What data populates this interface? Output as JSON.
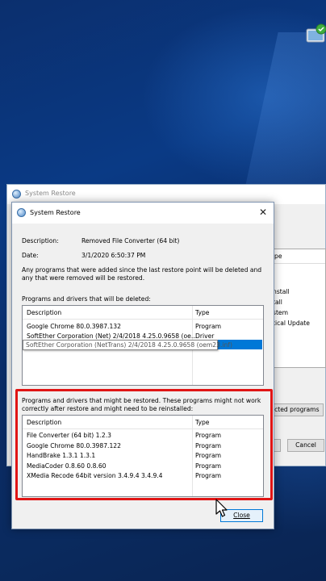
{
  "background_window": {
    "title": "System Restore",
    "list_header_suffix": "pe",
    "list_items": [
      "nstall",
      "tall",
      "stem",
      "tical Update"
    ],
    "scan_button_partial": "ected programs",
    "cancel_label": "Cancel"
  },
  "dialog": {
    "title": "System Restore",
    "description_label": "Description:",
    "description_value": "Removed File Converter (64 bit)",
    "date_label": "Date:",
    "date_value": "3/1/2020 6:50:37 PM",
    "info_text": "Any programs that were added since the last restore point will be deleted and any that were removed will be restored.",
    "deleted_section": {
      "caption": "Programs and drivers that will be deleted:",
      "columns": [
        "Description",
        "Type"
      ],
      "rows": [
        {
          "description": "Google Chrome 80.0.3987.132",
          "type": "Program"
        },
        {
          "description": "SoftEther Corporation (Net) 2/4/2018 4.25.0.9658 (oe...",
          "type": "Driver"
        }
      ],
      "dragged_row": "SoftEther Corporation (NetTrans) 2/4/2018 4.25.0.9658 (oem23.inf)"
    },
    "restored_section": {
      "caption": "Programs and drivers that might be restored. These programs might not work correctly after restore and might need to be reinstalled:",
      "columns": [
        "Description",
        "Type"
      ],
      "rows": [
        {
          "description": "File Converter (64 bit) 1.2.3",
          "type": "Program"
        },
        {
          "description": "Google Chrome 80.0.3987.122",
          "type": "Program"
        },
        {
          "description": "HandBrake 1.3.1 1.3.1",
          "type": "Program"
        },
        {
          "description": "MediaCoder 0.8.60 0.8.60",
          "type": "Program"
        },
        {
          "description": "XMedia Recode 64bit version 3.4.9.4 3.4.9.4",
          "type": "Program"
        }
      ]
    },
    "close_label": "Close"
  },
  "colors": {
    "highlight": "#e01515",
    "selection": "#0078d7",
    "desktop": "#0a2a62"
  }
}
